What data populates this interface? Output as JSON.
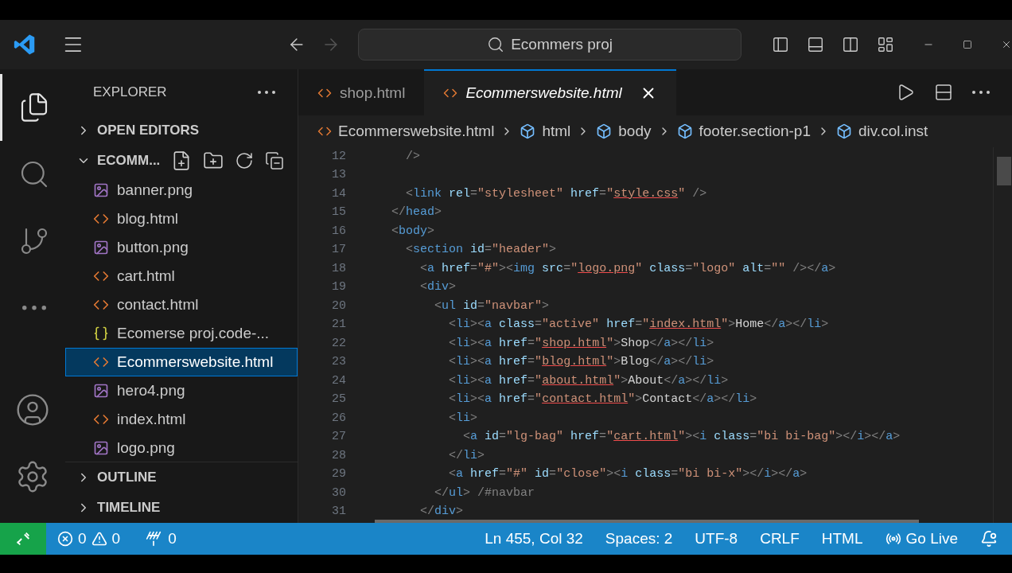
{
  "title_bar": {
    "search": "Ecommers proj",
    "forward_disabled": true
  },
  "activity_bar": [
    {
      "kind": "files",
      "selected": true
    },
    {
      "kind": "search",
      "selected": false
    },
    {
      "kind": "branch",
      "selected": false
    },
    {
      "kind": "more",
      "selected": false
    }
  ],
  "activity_bottom": [
    {
      "kind": "account"
    },
    {
      "kind": "settings"
    }
  ],
  "sidebar": {
    "title": "EXPLORER",
    "open_editors": {
      "label": "OPEN EDITORS",
      "expanded": false
    },
    "folder": {
      "label": "ECOMM...",
      "expanded": true,
      "files": [
        {
          "name": "banner.png",
          "kind": "image",
          "selected": false
        },
        {
          "name": "blog.html",
          "kind": "html",
          "selected": false
        },
        {
          "name": "button.png",
          "kind": "image",
          "selected": false
        },
        {
          "name": "cart.html",
          "kind": "html",
          "selected": false
        },
        {
          "name": "contact.html",
          "kind": "html",
          "selected": false
        },
        {
          "name": "Ecomerse proj.code-...",
          "kind": "json",
          "selected": false
        },
        {
          "name": "Ecommerswebsite.html",
          "kind": "html",
          "selected": true
        },
        {
          "name": "hero4.png",
          "kind": "image",
          "selected": false
        },
        {
          "name": "index.html",
          "kind": "html",
          "selected": false
        },
        {
          "name": "logo.png",
          "kind": "image",
          "selected": false
        }
      ]
    },
    "outline": {
      "label": "OUTLINE",
      "expanded": false
    },
    "timeline": {
      "label": "TIMELINE",
      "expanded": false
    }
  },
  "tabs": [
    {
      "label": "shop.html",
      "selected": false
    },
    {
      "label": "Ecommerswebsite.html",
      "selected": true
    }
  ],
  "breadcrumbs": [
    {
      "label": "Ecommerswebsite.html",
      "kind": "file"
    },
    {
      "label": "html",
      "kind": "element"
    },
    {
      "label": "body",
      "kind": "element"
    },
    {
      "label": "footer.section-p1",
      "kind": "element"
    },
    {
      "label": "div.col.inst",
      "kind": "element"
    }
  ],
  "code": [
    {
      "number": "12",
      "tokens": [
        {
          "kind": "p",
          "text": "    />"
        }
      ]
    },
    {
      "number": "13"
    },
    {
      "number": "14",
      "tokens": [
        {
          "kind": "p",
          "text": "    <"
        },
        {
          "kind": "tag",
          "text": "link"
        },
        {
          "kind": "attr",
          "text": " rel"
        },
        {
          "kind": "p",
          "text": "="
        },
        {
          "kind": "str",
          "text": "\"stylesheet\""
        },
        {
          "kind": "attr",
          "text": " href"
        },
        {
          "kind": "p",
          "text": "="
        },
        {
          "kind": "str",
          "text": "\""
        },
        {
          "kind": "link",
          "text": "style.css"
        },
        {
          "kind": "str",
          "text": "\""
        },
        {
          "kind": "p",
          "text": " />"
        }
      ]
    },
    {
      "number": "15",
      "tokens": [
        {
          "kind": "p",
          "text": "  </"
        },
        {
          "kind": "tag",
          "text": "head"
        },
        {
          "kind": "p",
          "text": ">"
        }
      ]
    },
    {
      "number": "16",
      "tokens": [
        {
          "kind": "p",
          "text": "  <"
        },
        {
          "kind": "tag",
          "text": "body"
        },
        {
          "kind": "p",
          "text": ">"
        }
      ]
    },
    {
      "number": "17",
      "tokens": [
        {
          "kind": "p",
          "text": "    <"
        },
        {
          "kind": "tag",
          "text": "section"
        },
        {
          "kind": "attr",
          "text": " id"
        },
        {
          "kind": "p",
          "text": "="
        },
        {
          "kind": "str",
          "text": "\"header\""
        },
        {
          "kind": "p",
          "text": ">"
        }
      ]
    },
    {
      "number": "18",
      "tokens": [
        {
          "kind": "p",
          "text": "      <"
        },
        {
          "kind": "tag",
          "text": "a"
        },
        {
          "kind": "attr",
          "text": " href"
        },
        {
          "kind": "p",
          "text": "="
        },
        {
          "kind": "str",
          "text": "\"#\""
        },
        {
          "kind": "p",
          "text": "><"
        },
        {
          "kind": "tag",
          "text": "img"
        },
        {
          "kind": "attr",
          "text": " src"
        },
        {
          "kind": "p",
          "text": "="
        },
        {
          "kind": "str",
          "text": "\""
        },
        {
          "kind": "link",
          "text": "logo.png"
        },
        {
          "kind": "str",
          "text": "\""
        },
        {
          "kind": "attr",
          "text": " class"
        },
        {
          "kind": "p",
          "text": "="
        },
        {
          "kind": "str",
          "text": "\"logo\""
        },
        {
          "kind": "attr",
          "text": " alt"
        },
        {
          "kind": "p",
          "text": "="
        },
        {
          "kind": "str",
          "text": "\"\""
        },
        {
          "kind": "p",
          "text": " /></"
        },
        {
          "kind": "tag",
          "text": "a"
        },
        {
          "kind": "p",
          "text": ">"
        }
      ]
    },
    {
      "number": "19",
      "tokens": [
        {
          "kind": "p",
          "text": "      <"
        },
        {
          "kind": "tag",
          "text": "div"
        },
        {
          "kind": "p",
          "text": ">"
        }
      ]
    },
    {
      "number": "20",
      "tokens": [
        {
          "kind": "p",
          "text": "        <"
        },
        {
          "kind": "tag",
          "text": "ul"
        },
        {
          "kind": "attr",
          "text": " id"
        },
        {
          "kind": "p",
          "text": "="
        },
        {
          "kind": "str",
          "text": "\"navbar\""
        },
        {
          "kind": "p",
          "text": ">"
        }
      ]
    },
    {
      "number": "21",
      "tokens": [
        {
          "kind": "p",
          "text": "          <"
        },
        {
          "kind": "tag",
          "text": "li"
        },
        {
          "kind": "p",
          "text": "><"
        },
        {
          "kind": "tag",
          "text": "a"
        },
        {
          "kind": "attr",
          "text": " class"
        },
        {
          "kind": "p",
          "text": "="
        },
        {
          "kind": "str",
          "text": "\"active\""
        },
        {
          "kind": "attr",
          "text": " href"
        },
        {
          "kind": "p",
          "text": "="
        },
        {
          "kind": "str",
          "text": "\""
        },
        {
          "kind": "link",
          "text": "index.html"
        },
        {
          "kind": "str",
          "text": "\""
        },
        {
          "kind": "p",
          "text": ">"
        },
        {
          "kind": "txt",
          "text": "Home"
        },
        {
          "kind": "p",
          "text": "</"
        },
        {
          "kind": "tag",
          "text": "a"
        },
        {
          "kind": "p",
          "text": "></"
        },
        {
          "kind": "tag",
          "text": "li"
        },
        {
          "kind": "p",
          "text": ">"
        }
      ]
    },
    {
      "number": "22",
      "tokens": [
        {
          "kind": "p",
          "text": "          <"
        },
        {
          "kind": "tag",
          "text": "li"
        },
        {
          "kind": "p",
          "text": "><"
        },
        {
          "kind": "tag",
          "text": "a"
        },
        {
          "kind": "attr",
          "text": " href"
        },
        {
          "kind": "p",
          "text": "="
        },
        {
          "kind": "str",
          "text": "\""
        },
        {
          "kind": "link",
          "text": "shop.html"
        },
        {
          "kind": "str",
          "text": "\""
        },
        {
          "kind": "p",
          "text": ">"
        },
        {
          "kind": "txt",
          "text": "Shop"
        },
        {
          "kind": "p",
          "text": "</"
        },
        {
          "kind": "tag",
          "text": "a"
        },
        {
          "kind": "p",
          "text": "></"
        },
        {
          "kind": "tag",
          "text": "li"
        },
        {
          "kind": "p",
          "text": ">"
        }
      ]
    },
    {
      "number": "23",
      "tokens": [
        {
          "kind": "p",
          "text": "          <"
        },
        {
          "kind": "tag",
          "text": "li"
        },
        {
          "kind": "p",
          "text": "><"
        },
        {
          "kind": "tag",
          "text": "a"
        },
        {
          "kind": "attr",
          "text": " href"
        },
        {
          "kind": "p",
          "text": "="
        },
        {
          "kind": "str",
          "text": "\""
        },
        {
          "kind": "link",
          "text": "blog.html"
        },
        {
          "kind": "str",
          "text": "\""
        },
        {
          "kind": "p",
          "text": ">"
        },
        {
          "kind": "txt",
          "text": "Blog"
        },
        {
          "kind": "p",
          "text": "</"
        },
        {
          "kind": "tag",
          "text": "a"
        },
        {
          "kind": "p",
          "text": "></"
        },
        {
          "kind": "tag",
          "text": "li"
        },
        {
          "kind": "p",
          "text": ">"
        }
      ]
    },
    {
      "number": "24",
      "tokens": [
        {
          "kind": "p",
          "text": "          <"
        },
        {
          "kind": "tag",
          "text": "li"
        },
        {
          "kind": "p",
          "text": "><"
        },
        {
          "kind": "tag",
          "text": "a"
        },
        {
          "kind": "attr",
          "text": " href"
        },
        {
          "kind": "p",
          "text": "="
        },
        {
          "kind": "str",
          "text": "\""
        },
        {
          "kind": "link",
          "text": "about.html"
        },
        {
          "kind": "str",
          "text": "\""
        },
        {
          "kind": "p",
          "text": ">"
        },
        {
          "kind": "txt",
          "text": "About"
        },
        {
          "kind": "p",
          "text": "</"
        },
        {
          "kind": "tag",
          "text": "a"
        },
        {
          "kind": "p",
          "text": "></"
        },
        {
          "kind": "tag",
          "text": "li"
        },
        {
          "kind": "p",
          "text": ">"
        }
      ]
    },
    {
      "number": "25",
      "tokens": [
        {
          "kind": "p",
          "text": "          <"
        },
        {
          "kind": "tag",
          "text": "li"
        },
        {
          "kind": "p",
          "text": "><"
        },
        {
          "kind": "tag",
          "text": "a"
        },
        {
          "kind": "attr",
          "text": " href"
        },
        {
          "kind": "p",
          "text": "="
        },
        {
          "kind": "str",
          "text": "\""
        },
        {
          "kind": "link",
          "text": "contact.html"
        },
        {
          "kind": "str",
          "text": "\""
        },
        {
          "kind": "p",
          "text": ">"
        },
        {
          "kind": "txt",
          "text": "Contact"
        },
        {
          "kind": "p",
          "text": "</"
        },
        {
          "kind": "tag",
          "text": "a"
        },
        {
          "kind": "p",
          "text": "></"
        },
        {
          "kind": "tag",
          "text": "li"
        },
        {
          "kind": "p",
          "text": ">"
        }
      ]
    },
    {
      "number": "26",
      "tokens": [
        {
          "kind": "p",
          "text": "          <"
        },
        {
          "kind": "tag",
          "text": "li"
        },
        {
          "kind": "p",
          "text": ">"
        }
      ]
    },
    {
      "number": "27",
      "tokens": [
        {
          "kind": "p",
          "text": "            <"
        },
        {
          "kind": "tag",
          "text": "a"
        },
        {
          "kind": "attr",
          "text": " id"
        },
        {
          "kind": "p",
          "text": "="
        },
        {
          "kind": "str",
          "text": "\"lg-bag\""
        },
        {
          "kind": "attr",
          "text": " href"
        },
        {
          "kind": "p",
          "text": "="
        },
        {
          "kind": "str",
          "text": "\""
        },
        {
          "kind": "link",
          "text": "cart.html"
        },
        {
          "kind": "str",
          "text": "\""
        },
        {
          "kind": "p",
          "text": "><"
        },
        {
          "kind": "tag",
          "text": "i"
        },
        {
          "kind": "attr",
          "text": " class"
        },
        {
          "kind": "p",
          "text": "="
        },
        {
          "kind": "str",
          "text": "\"bi bi-bag\""
        },
        {
          "kind": "p",
          "text": "></"
        },
        {
          "kind": "tag",
          "text": "i"
        },
        {
          "kind": "p",
          "text": "></"
        },
        {
          "kind": "tag",
          "text": "a"
        },
        {
          "kind": "p",
          "text": ">"
        }
      ]
    },
    {
      "number": "28",
      "tokens": [
        {
          "kind": "p",
          "text": "          </"
        },
        {
          "kind": "tag",
          "text": "li"
        },
        {
          "kind": "p",
          "text": ">"
        }
      ]
    },
    {
      "number": "29",
      "tokens": [
        {
          "kind": "p",
          "text": "          <"
        },
        {
          "kind": "tag",
          "text": "a"
        },
        {
          "kind": "attr",
          "text": " href"
        },
        {
          "kind": "p",
          "text": "="
        },
        {
          "kind": "str",
          "text": "\"#\""
        },
        {
          "kind": "attr",
          "text": " id"
        },
        {
          "kind": "p",
          "text": "="
        },
        {
          "kind": "str",
          "text": "\"close\""
        },
        {
          "kind": "p",
          "text": "><"
        },
        {
          "kind": "tag",
          "text": "i"
        },
        {
          "kind": "attr",
          "text": " class"
        },
        {
          "kind": "p",
          "text": "="
        },
        {
          "kind": "str",
          "text": "\"bi bi-x\""
        },
        {
          "kind": "p",
          "text": "></"
        },
        {
          "kind": "tag",
          "text": "i"
        },
        {
          "kind": "p",
          "text": "></"
        },
        {
          "kind": "tag",
          "text": "a"
        },
        {
          "kind": "p",
          "text": ">"
        }
      ]
    },
    {
      "number": "30",
      "tokens": [
        {
          "kind": "p",
          "text": "        </"
        },
        {
          "kind": "tag",
          "text": "ul"
        },
        {
          "kind": "p",
          "text": ">"
        },
        {
          "kind": "p",
          "text": " /#navbar"
        }
      ]
    },
    {
      "number": "31",
      "tokens": [
        {
          "kind": "p",
          "text": "      </"
        },
        {
          "kind": "tag",
          "text": "div"
        },
        {
          "kind": "p",
          "text": ">"
        }
      ]
    }
  ],
  "status_bar": {
    "errors": "0",
    "warnings": "0",
    "ports": "0",
    "items": [
      "Ln 455, Col 32",
      "Spaces: 2",
      "UTF-8",
      "CRLF",
      "HTML"
    ],
    "go_live": "Go Live"
  }
}
